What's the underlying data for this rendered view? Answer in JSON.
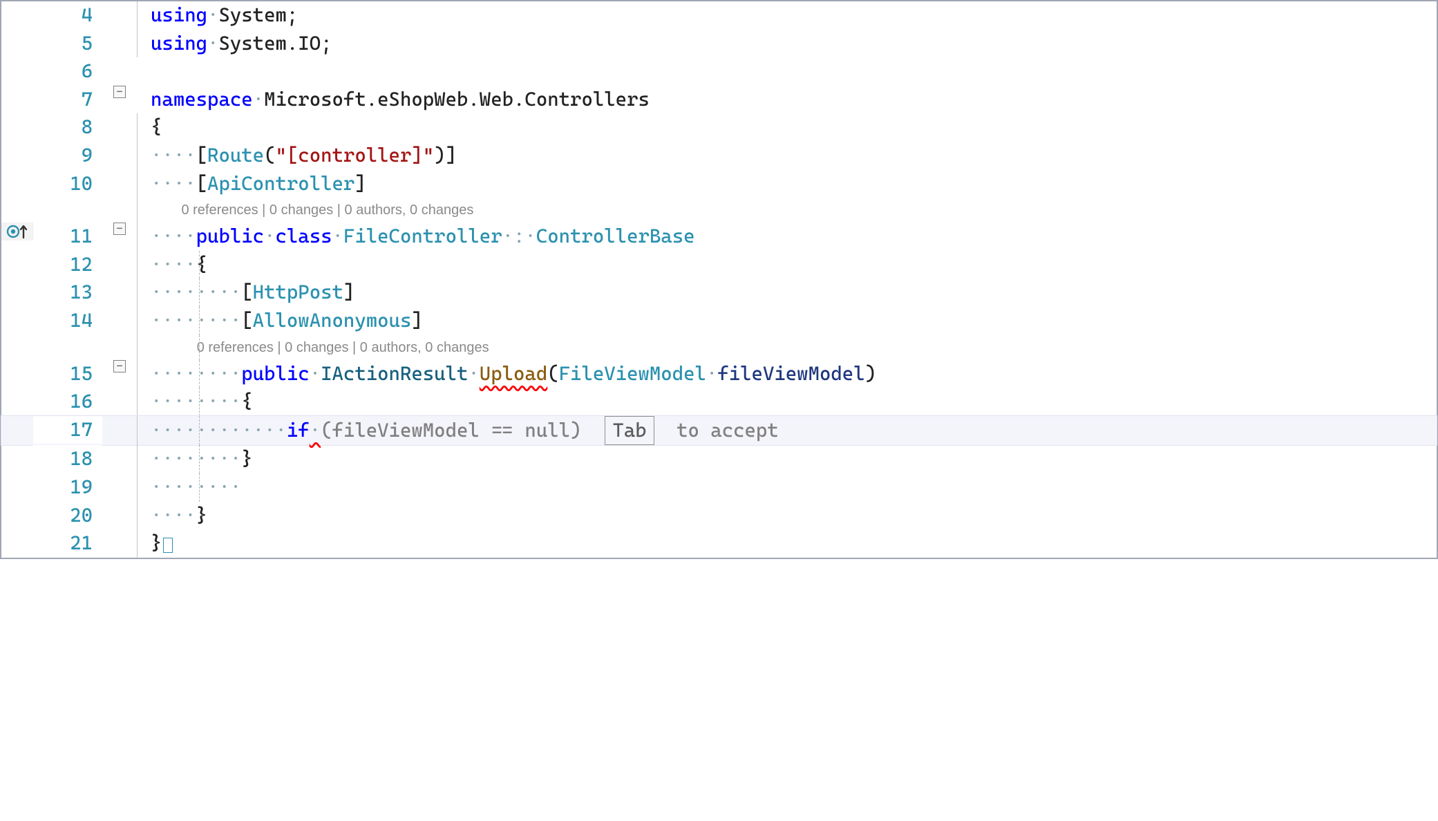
{
  "colors": {
    "keyword": "#0000ff",
    "type": "#2b91af",
    "string": "#a31515",
    "codelens": "#8a8a8a",
    "changebar": "#d69d1f"
  },
  "lines": {
    "l4": {
      "num": "4",
      "using": "using",
      "dot": "·",
      "ns": "System",
      "semi": ";"
    },
    "l5": {
      "num": "5",
      "using": "using",
      "dot": "·",
      "ns": "System.IO",
      "semi": ";"
    },
    "l6": {
      "num": "6"
    },
    "l7": {
      "num": "7",
      "kw": "namespace",
      "dot": "·",
      "name": "Microsoft.eShopWeb.Web.Controllers"
    },
    "l8": {
      "num": "8",
      "brace": "{"
    },
    "l9": {
      "num": "9",
      "dots": "····",
      "open": "[",
      "attr": "Route",
      "paren": "(",
      "str": "\"[controller]\"",
      "close": ")]"
    },
    "l10": {
      "num": "10",
      "dots": "····",
      "open": "[",
      "attr": "ApiController",
      "close": "]"
    },
    "cl1": {
      "text": "0 references | 0 changes | 0 authors, 0 changes",
      "indent": "        "
    },
    "l11": {
      "num": "11",
      "dots": "····",
      "kw1": "public",
      "sp": "·",
      "kw2": "class",
      "name": "FileController",
      "colon": "·:·",
      "base": "ControllerBase"
    },
    "l12": {
      "num": "12",
      "dots": "····",
      "brace": "{"
    },
    "l13": {
      "num": "13",
      "dots": "········",
      "open": "[",
      "attr": "HttpPost",
      "close": "]"
    },
    "l14": {
      "num": "14",
      "dots": "········",
      "open": "[",
      "attr": "AllowAnonymous",
      "close": "]"
    },
    "cl2": {
      "text": "0 references | 0 changes | 0 authors, 0 changes",
      "indent": "            "
    },
    "l15": {
      "num": "15",
      "dots": "········",
      "kw": "public",
      "sp": "·",
      "ret": "IActionResult",
      "m": "Upload",
      "po": "(",
      "pt": "FileViewModel",
      "pn": "fileViewModel",
      "pc": ")"
    },
    "l16": {
      "num": "16",
      "dots": "········",
      "brace": "{"
    },
    "l17": {
      "num": "17",
      "dots": "············",
      "kw": "if",
      "sp": "·",
      "rest": "(fileViewModel == null)",
      "tab": "Tab",
      "hint": " to accept"
    },
    "l18": {
      "num": "18",
      "dots": "········",
      "brace": "}"
    },
    "l19": {
      "num": "19",
      "dots": "········"
    },
    "l20": {
      "num": "20",
      "dots": "····",
      "brace": "}"
    },
    "l21": {
      "num": "21",
      "brace": "}"
    }
  },
  "icons": {
    "circle": "◎",
    "arrow": "↑",
    "fold": "⊟",
    "bulb": "lightbulb"
  }
}
